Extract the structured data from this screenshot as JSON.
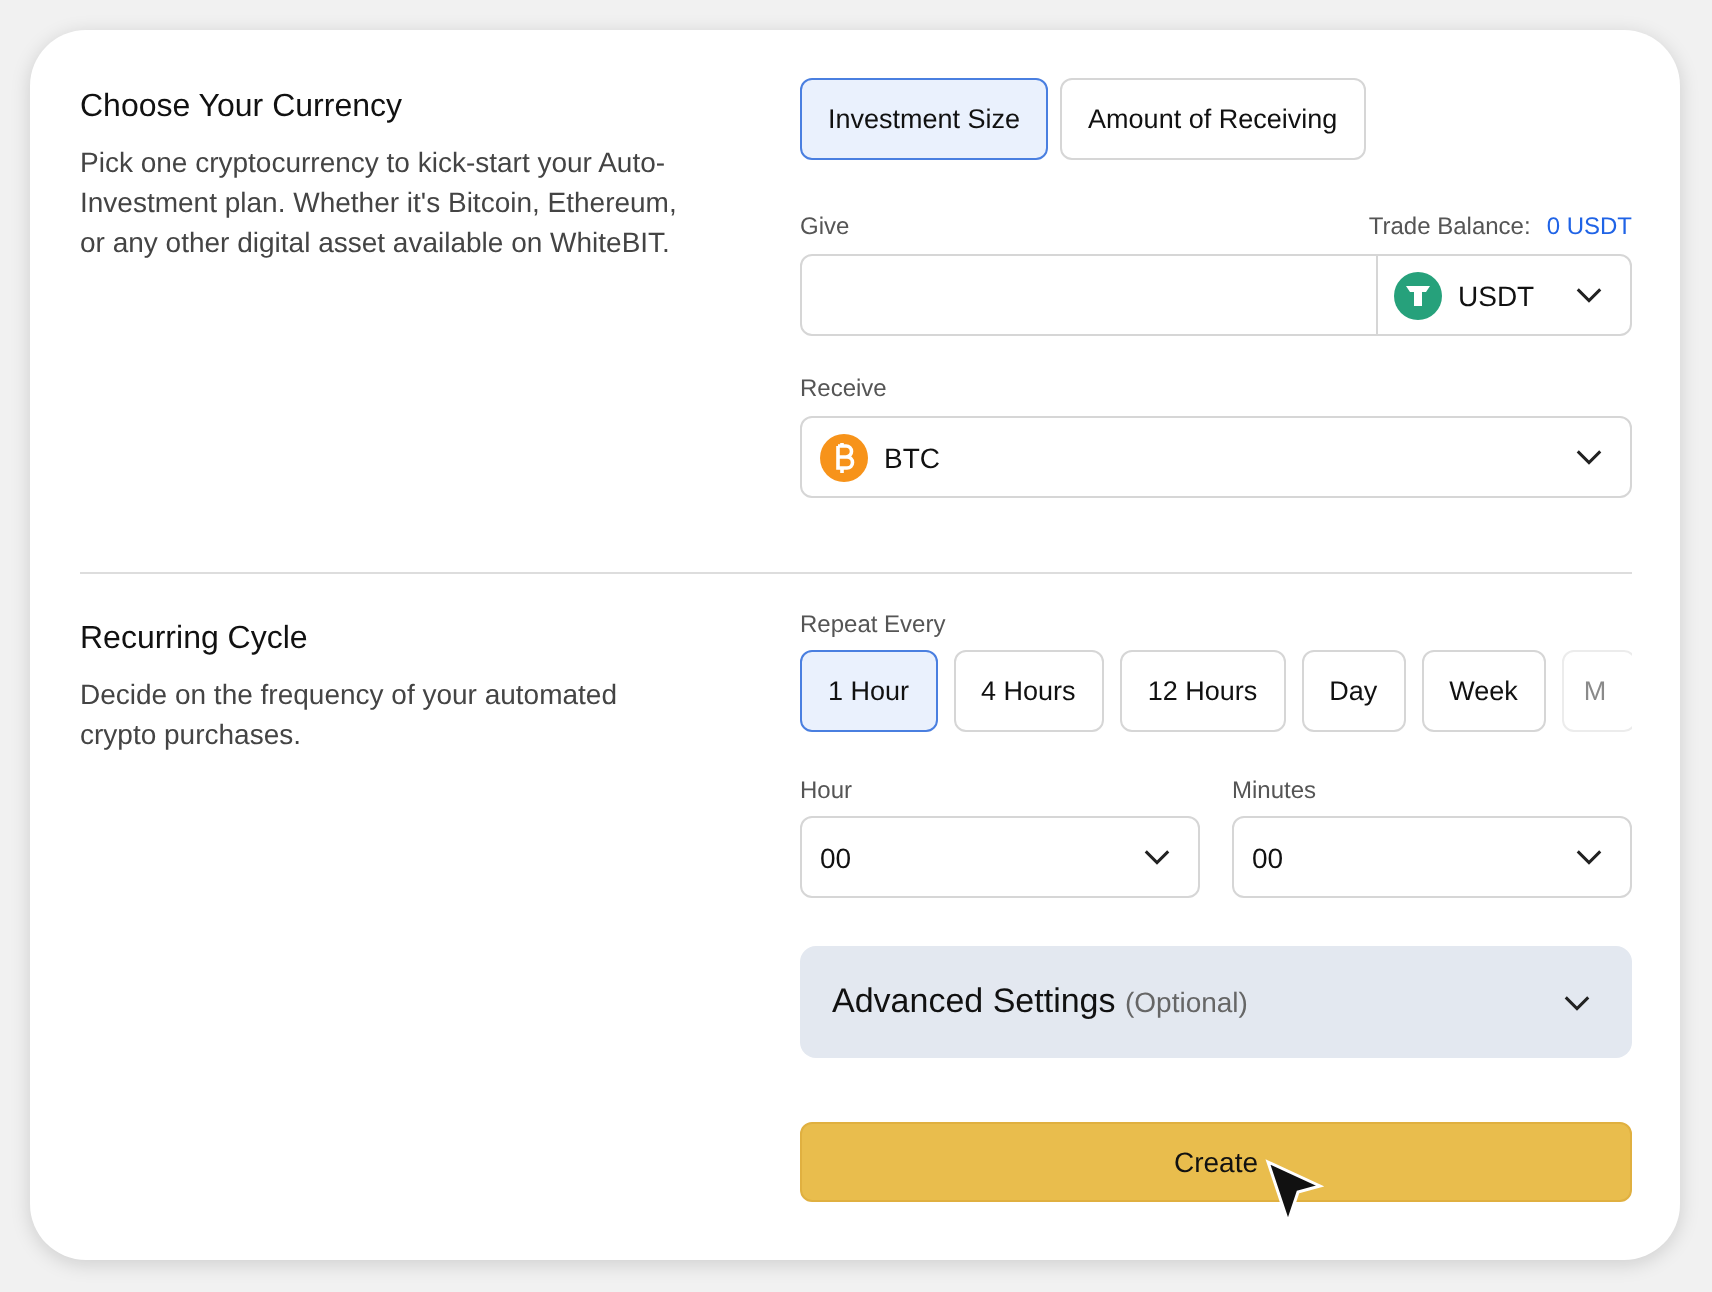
{
  "sections": [
    {
      "title": "Choose Your Currency",
      "description": "Pick one cryptocurrency to kick-start your Auto-Investment plan. Whether it's Bitcoin, Ethereum, or any other digital asset available on WhiteBIT."
    },
    {
      "title": "Recurring Cycle",
      "description": "Decide on the frequency of your automated crypto purchases."
    }
  ],
  "mode_tabs": [
    {
      "label": "Investment Size",
      "selected": true
    },
    {
      "label": "Amount of Receiving",
      "selected": false
    }
  ],
  "give": {
    "label": "Give",
    "balance_label": "Trade Balance:",
    "balance_value": "0 USDT",
    "currency": "USDT"
  },
  "receive": {
    "label": "Receive",
    "currency": "BTC"
  },
  "repeat": {
    "label": "Repeat Every",
    "options": [
      {
        "label": "1 Hour",
        "selected": true
      },
      {
        "label": "4 Hours",
        "selected": false
      },
      {
        "label": "12 Hours",
        "selected": false
      },
      {
        "label": "Day",
        "selected": false
      },
      {
        "label": "Week",
        "selected": false
      },
      {
        "label": "M",
        "selected": false
      }
    ]
  },
  "hour": {
    "label": "Hour",
    "value": "00"
  },
  "minutes": {
    "label": "Minutes",
    "value": "00"
  },
  "advanced": {
    "title": "Advanced Settings",
    "note": "(Optional)",
    "expanded": false
  },
  "create_button": "Create"
}
